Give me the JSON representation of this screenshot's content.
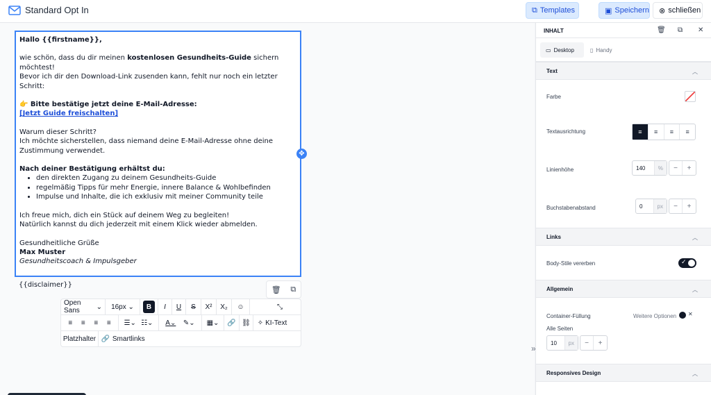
{
  "header": {
    "title": "Standard Opt In",
    "templates_label": "Templates",
    "save_label": "Speichern",
    "close_label": "schließen"
  },
  "email": {
    "greeting": "Hallo {{firstname}},",
    "intro_pre": "wie schön, dass du dir meinen ",
    "intro_bold": "kostenlosen Gesundheits-Guide",
    "intro_post": " sichern möchtest!",
    "intro_line2": "Bevor ich dir den Download-Link zusenden kann, fehlt nur noch ein letzter Schritt:",
    "confirm_heading": "👉 Bitte bestätige jetzt deine E-Mail-Adresse:",
    "confirm_link": "[Jetzt Guide freischalten]",
    "why_line1": "Warum dieser Schritt?",
    "why_line2": "Ich möchte sicherstellen, dass niemand deine E-Mail-Adresse ohne deine Zustimmung verwendet.",
    "after_heading": "Nach deiner Bestätigung erhältst du:",
    "bullets": [
      "den direkten Zugang zu deinem Gesundheits-Guide",
      "regelmäßig Tipps für mehr Energie, innere Balance & Wohlbefinden",
      "Impulse und Inhalte, die ich exklusiv mit meiner Community teile"
    ],
    "closing_line1": "Ich freue mich, dich ein Stück auf deinem Weg zu begleiten!",
    "closing_line2": "Natürlich kannst du dich jederzeit mit einem Klick wieder abmelden.",
    "regards": "Gesundheitliche Grüße",
    "name": "Max Muster",
    "role": "Gesundheitscoach & Impulsgeber",
    "disclaimer": "{{disclaimer}}"
  },
  "toolbar": {
    "font_family": "Open Sans",
    "font_size": "16px",
    "bold": "B",
    "italic": "I",
    "underline": "U",
    "strike": "S",
    "superscript": "X²",
    "subscript": "X₂",
    "text_color": "A",
    "ai_text": "KI-Text",
    "placeholder": "Platzhalter",
    "smartlinks": "Smartlinks"
  },
  "panel": {
    "title": "INHALT",
    "tab_desktop": "Desktop",
    "tab_handy": "Handy",
    "section_text": "Text",
    "farbe": "Farbe",
    "textausrichtung": "Textausrichtung",
    "linienhoehe": "Linienhöhe",
    "linienhoehe_value": "140",
    "linienhoehe_unit": "%",
    "buchstabenabstand": "Buchstabenabstand",
    "buchstabenabstand_value": "0",
    "buchstabenabstand_unit": "px",
    "section_links": "Links",
    "body_stile": "Body-Stile vererben",
    "section_allgemein": "Allgemein",
    "container_fuellung": "Container-Füllung",
    "weitere_optionen": "Weitere Optionen",
    "alle_seiten": "Alle Seiten",
    "padding_value": "10",
    "padding_unit": "px",
    "section_responsive": "Responsives Design"
  },
  "colors": {
    "accent": "#3b82f6",
    "accent_light": "#dbeafe",
    "dark": "#111827"
  }
}
